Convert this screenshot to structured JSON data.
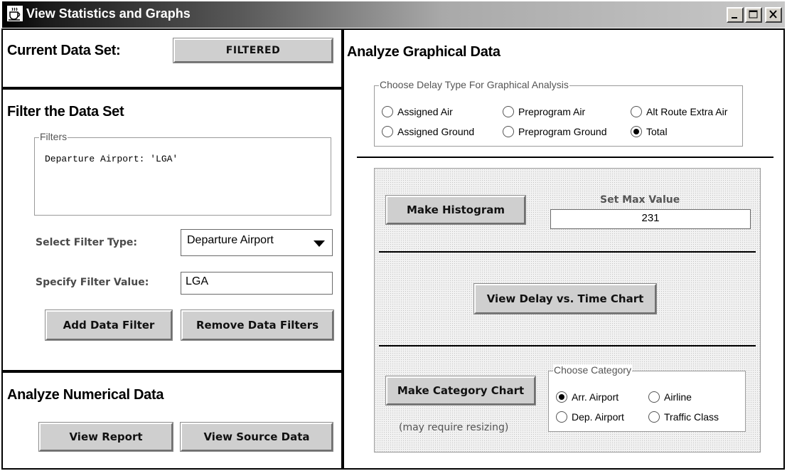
{
  "window": {
    "title": "View Statistics and Graphs",
    "icon": "java-coffee-cup-icon",
    "controls": [
      "minimize-icon",
      "maximize-icon",
      "close-icon"
    ]
  },
  "left": {
    "current_data_set": {
      "label": "Current Data Set:",
      "value": "FILTERED"
    },
    "filter_section": {
      "heading": "Filter the Data Set",
      "filters_legend": "Filters",
      "filters_text": "Departure Airport: 'LGA'",
      "select_filter_type_label": "Select Filter Type:",
      "select_filter_type_value": "Departure Airport",
      "specify_filter_value_label": "Specify Filter Value:",
      "specify_filter_value": "LGA",
      "add_button": "Add Data Filter",
      "remove_button": "Remove Data Filters"
    },
    "numerical_section": {
      "heading": "Analyze Numerical Data",
      "view_report_button": "View Report",
      "view_source_button": "View Source Data"
    }
  },
  "right": {
    "heading": "Analyze Graphical Data",
    "delay_type": {
      "legend": "Choose Delay Type For Graphical Analysis",
      "options": [
        {
          "label": "Assigned Air",
          "selected": false
        },
        {
          "label": "Preprogram Air",
          "selected": false
        },
        {
          "label": "Alt Route Extra Air",
          "selected": false
        },
        {
          "label": "Assigned Ground",
          "selected": false
        },
        {
          "label": "Preprogram Ground",
          "selected": false
        },
        {
          "label": "Total",
          "selected": true
        }
      ]
    },
    "histogram": {
      "button": "Make Histogram",
      "max_label": "Set Max Value",
      "max_value": "231"
    },
    "delay_time_chart_button": "View Delay vs. Time Chart",
    "category": {
      "button": "Make Category Chart",
      "note": "(may require resizing)",
      "legend": "Choose Category",
      "options": [
        {
          "label": "Arr. Airport",
          "selected": true
        },
        {
          "label": "Airline",
          "selected": false
        },
        {
          "label": "Dep. Airport",
          "selected": false
        },
        {
          "label": "Traffic Class",
          "selected": false
        }
      ]
    }
  }
}
